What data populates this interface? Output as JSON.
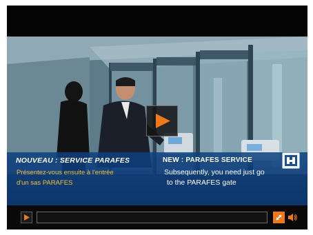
{
  "player": {
    "accent_color": "#f07a1a",
    "caption_band_color": "#0c4080",
    "caption_fr_text_color": "#f3c340"
  },
  "captions": {
    "fr_title": "NOUVEAU : SERVICE PARAFES",
    "fr_line1": "Présentez-vous ensuite à l'entrée",
    "fr_line2": "d'un sas PARAFES",
    "en_title": "NEW : PARAFES SERVICE",
    "en_line1": "Subsequently, you need just go",
    "en_line2": "to the PARAFES gate"
  },
  "icons": {
    "big_play": "play-icon",
    "control_play": "play-icon",
    "fullscreen": "fullscreen-icon",
    "volume": "speaker-icon",
    "logo": "building-logo-icon"
  }
}
